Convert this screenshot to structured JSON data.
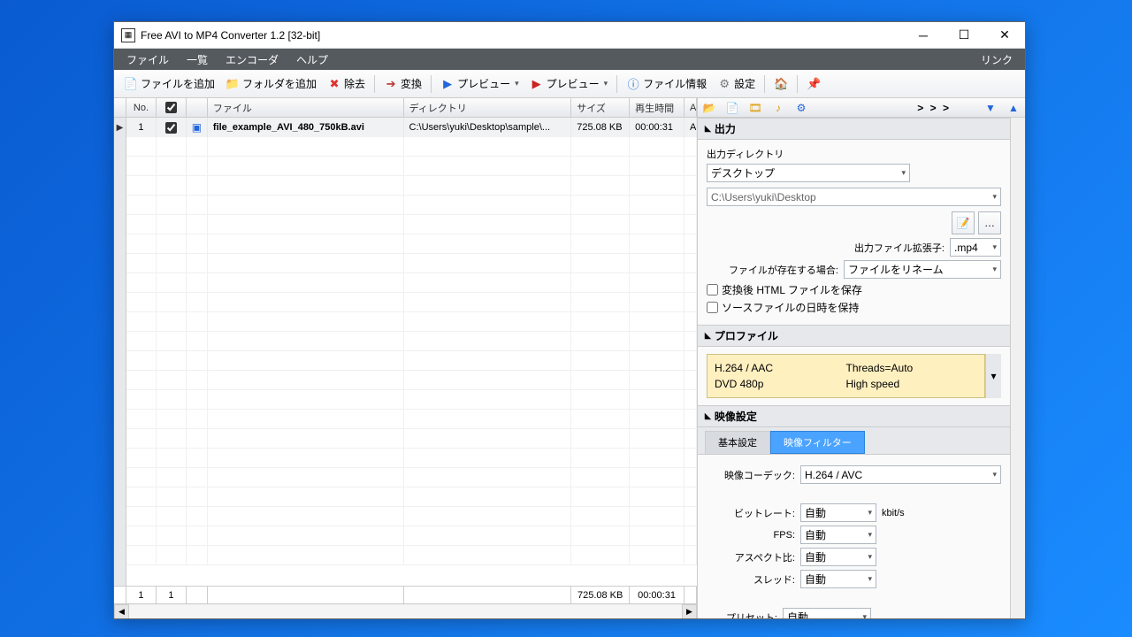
{
  "window": {
    "title": "Free AVI to MP4 Converter 1.2  [32-bit]"
  },
  "menu": {
    "file": "ファイル",
    "list": "一覧",
    "encoder": "エンコーダ",
    "help": "ヘルプ",
    "link": "リンク"
  },
  "toolbar": {
    "add_file": "ファイルを追加",
    "add_folder": "フォルダを追加",
    "remove": "除去",
    "convert": "変換",
    "preview1": "プレビュー",
    "preview2": "プレビュー",
    "file_info": "ファイル情報",
    "settings": "設定"
  },
  "grid": {
    "headers": {
      "no": "No.",
      "file": "ファイル",
      "directory": "ディレクトリ",
      "size": "サイズ",
      "duration": "再生時間",
      "a": "A"
    },
    "rows": [
      {
        "no": "1",
        "checked": true,
        "file": "file_example_AVI_480_750kB.avi",
        "directory": "C:\\Users\\yuki\\Desktop\\sample\\...",
        "size": "725.08 KB",
        "duration": "00:00:31",
        "a": "A"
      }
    ],
    "status": {
      "c1": "1",
      "c2": "1",
      "size": "725.08 KB",
      "duration": "00:00:31"
    }
  },
  "right_tabs_more": "> > >",
  "output": {
    "header": "出力",
    "dir_label": "出力ディレクトリ",
    "dir_value": "デスクトップ",
    "path": "C:\\Users\\yuki\\Desktop",
    "ext_label": "出力ファイル拡張子:",
    "ext_value": ".mp4",
    "exists_label": "ファイルが存在する場合:",
    "exists_value": "ファイルをリネーム",
    "chk_html": "変換後 HTML ファイルを保存",
    "chk_date": "ソースファイルの日時を保持"
  },
  "profile": {
    "header": "プロファイル",
    "codec": "H.264 / AAC",
    "res": "DVD 480p",
    "threads": "Threads=Auto",
    "speed": "High speed"
  },
  "video": {
    "header": "映像設定",
    "tab_basic": "基本設定",
    "tab_filter": "映像フィルター",
    "codec_label": "映像コーデック:",
    "codec_value": "H.264 / AVC",
    "bitrate_label": "ビットレート:",
    "bitrate_value": "自動",
    "bitrate_unit": "kbit/s",
    "fps_label": "FPS:",
    "fps_value": "自動",
    "aspect_label": "アスペクト比:",
    "aspect_value": "自動",
    "thread_label": "スレッド:",
    "thread_value": "自動",
    "preset_label": "プリセット:",
    "preset_value": "自動"
  }
}
